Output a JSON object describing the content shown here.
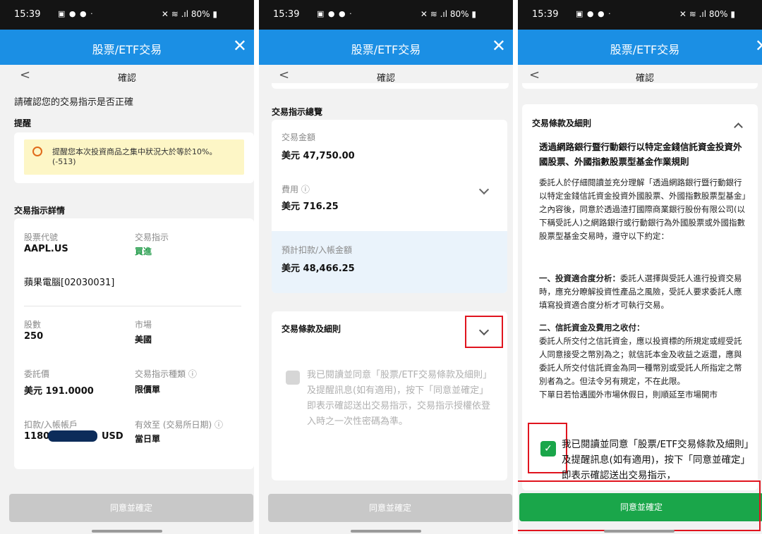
{
  "status": {
    "time": "15:39",
    "icons": "▣ ● ● ·",
    "right": "✕ ≋ .ıl 80% ▮"
  },
  "app": {
    "title": "股票/ETF交易",
    "nav_title": "確認",
    "back": "<",
    "close": "✕"
  },
  "screen1": {
    "intro": "請確認您的交易指示是否正確",
    "reminder_heading": "提醒",
    "reminder_line1": "提醒您本次投資商品之集中狀況大於等於10%。",
    "reminder_line2": "(-513)",
    "details_heading": "交易指示詳情",
    "stock_code_label": "股票代號",
    "stock_code": "AAPL.US",
    "order_label": "交易指示",
    "order_value": "買進",
    "stock_name": "蘋果電腦[02030031]",
    "shares_label": "股數",
    "shares": "250",
    "market_label": "市場",
    "market": "美國",
    "price_label": "委託價",
    "price": "美元 191.0000",
    "order_type_label": "交易指示種類 ⓘ",
    "order_type": "限價單",
    "account_label": "扣款/入帳帳戶",
    "account_prefix": "1180",
    "account_suffix": "USD",
    "valid_label": "有效至 (交易所日期) ⓘ",
    "valid_value": "當日單"
  },
  "screen2": {
    "overview_heading": "交易指示總覽",
    "amount_label": "交易金額",
    "amount": "美元 47,750.00",
    "fee_label": "費用 ⓘ",
    "fee": "美元 716.25",
    "expected_label": "預計扣款/入帳金額",
    "expected": "美元 48,466.25",
    "terms_heading": "交易條款及細則",
    "agree_text": "我已閱讀並同意「股票/ETF交易條款及細則」及提醒訊息(如有適用)，按下「同意並確定」即表示確認送出交易指示，交易指示授權依登入時之一次性密碼為準。"
  },
  "screen3": {
    "terms_heading": "交易條款及細則",
    "rules_title": "透過網路銀行暨行動銀行以特定金錢信託資金投資外國股票、外國指數股票型基金作業規則",
    "para1": "委託人於仔細閱讀並充分理解「透過網路銀行暨行動銀行以特定金錢信託資金投資外國股票、外國指數股票型基金」之內容後，同意於透過渣打國際商業銀行股份有限公司(以下稱受託人)之網路銀行或行動銀行為外國股票或外國指數股票型基金交易時，遵守以下約定：",
    "sec1_title": "一、投資適合度分析：",
    "sec1_text": "委託人選擇與受託人進行投資交易時，應充分瞭解投資性產品之風險，受託人要求委託人應填寫投資適合度分析才可執行交易。",
    "sec2_title": "二、信託資金及費用之收付：",
    "sec2_text": "委託人所交付之信託資金，應以投資標的所規定或經受託人同意接受之幣別為之；就信託本金及收益之返還，應與委託人所交付信託資金為同一種幣別或受託人所指定之幣別者為之。但法令另有規定，不在此限。",
    "sec2_more": "下單日若恰遇國外市場休假日，則順延至市場開市",
    "agree_text": "我已閱讀並同意「股票/ETF交易條款及細則」及提醒訊息(如有適用)，按下「同意並確定」即表示確認送出交易指示，"
  },
  "confirm_label": "同意並確定",
  "colors": {
    "app_bar": "#1b8fe4",
    "confirm_enabled": "#1aa64a",
    "confirm_disabled": "#c8c8c8",
    "highlight": "#e0141e"
  }
}
